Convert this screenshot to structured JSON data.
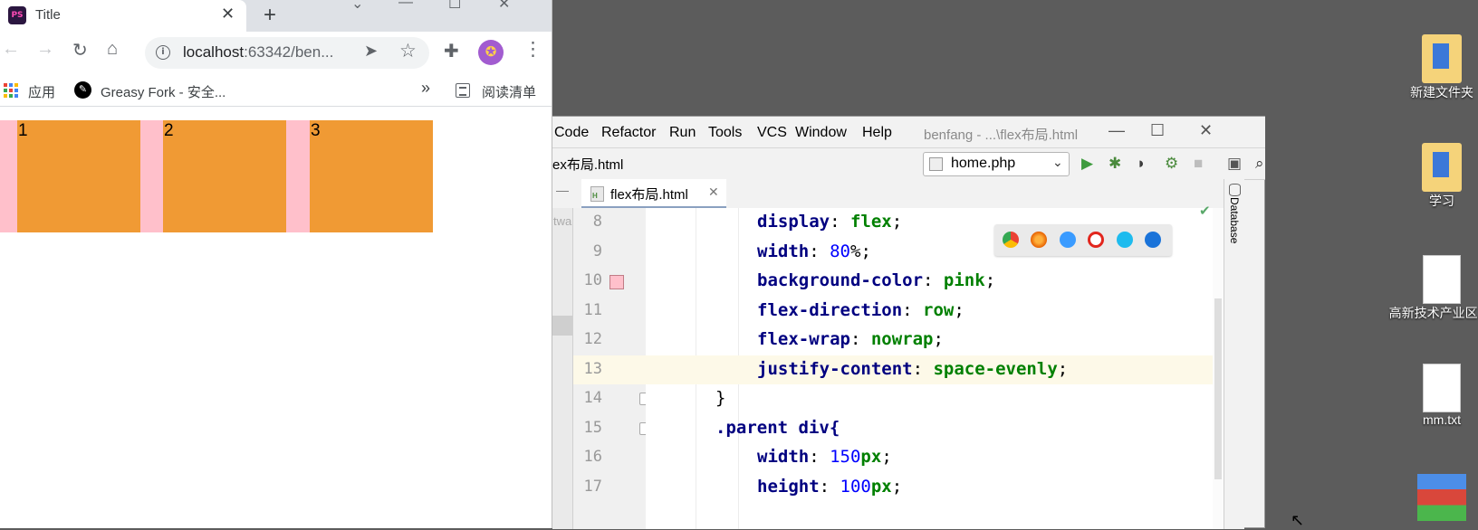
{
  "browser": {
    "tab_title": "Title",
    "favicon_text": "PS",
    "url_host": "localhost",
    "url_rest": ":63342/ben...",
    "bookmarks": [
      "应用",
      "Greasy Fork - 安全..."
    ],
    "reading_list": "阅读清单",
    "more_glyph": "»",
    "page": {
      "boxes": [
        "1",
        "2",
        "3"
      ],
      "parent_color": "#ffc0cb",
      "child_color": "#f09a34"
    }
  },
  "ide": {
    "menu": [
      "Code",
      "Refactor",
      "Run",
      "Tools",
      "VCS",
      "Window",
      "Help"
    ],
    "title": "benfang - ...\\flex布局.html",
    "breadcrumb": "ex布局.html",
    "run_config": "home.php",
    "editor_tab": "flex布局.html",
    "left_strip_text": "twa",
    "right_tool": "Database",
    "lines": [
      {
        "num": "8",
        "prop": "display",
        "value": "flex",
        "unit": ""
      },
      {
        "num": "9",
        "prop": "width",
        "value": "80",
        "unit": "%"
      },
      {
        "num": "10",
        "prop": "background-color",
        "value": "pink",
        "unit": ""
      },
      {
        "num": "11",
        "prop": "flex-direction",
        "value": "row",
        "unit": ""
      },
      {
        "num": "12",
        "prop": "flex-wrap",
        "value": "nowrap",
        "unit": ""
      },
      {
        "num": "13",
        "prop": "justify-content",
        "value": "space-evenly",
        "unit": ""
      },
      {
        "num": "14",
        "text": "}"
      },
      {
        "num": "15",
        "text": ".parent div{"
      },
      {
        "num": "16",
        "prop": "width",
        "value": "150",
        "unit": "px"
      },
      {
        "num": "17",
        "prop": "height",
        "value": "100",
        "unit": "px"
      }
    ],
    "browsers_popup": [
      "chrome-icon",
      "firefox-icon",
      "safari-icon",
      "opera-icon",
      "ie-icon",
      "edge-icon"
    ]
  },
  "desktop": {
    "icons": [
      "新建文件夹",
      "学习",
      "高新技术产业区.txt",
      "mm.txt"
    ]
  }
}
